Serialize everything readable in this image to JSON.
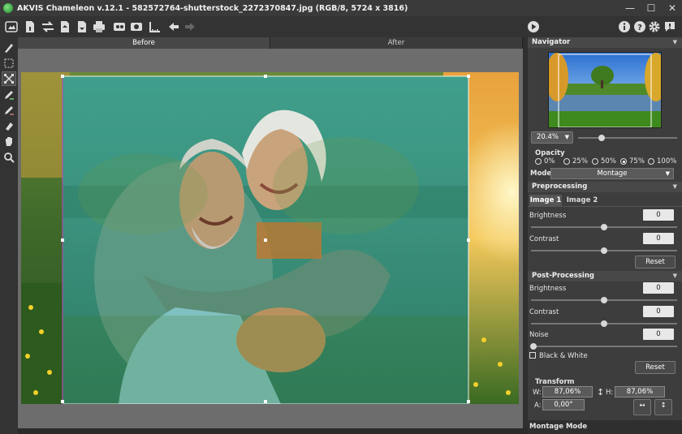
{
  "window": {
    "title": "AKVIS Chameleon v.12.1 - 582572764-shutterstock_2272370847.jpg (RGB/8, 5724 x 3816)"
  },
  "toolbar": {
    "icons": [
      "open-image-icon",
      "save-as-icon",
      "swap-images-icon",
      "upload-icon",
      "download-icon",
      "print-icon",
      "share-icon",
      "batch-icon",
      "ruler-icon",
      "undo-icon",
      "redo-icon",
      "run-icon",
      "info-icon",
      "help-icon",
      "settings-icon",
      "notifications-icon"
    ]
  },
  "tools": [
    "hand-brush-icon",
    "selection-icon",
    "chameleon-mode-icon",
    "mask-pencil-icon",
    "eraser-icon",
    "eraser2-icon",
    "hand-tool-icon",
    "zoom-tool-icon"
  ],
  "view_tabs": {
    "before": "Before",
    "after": "After"
  },
  "navigator": {
    "title": "Navigator",
    "zoom": "20.4%"
  },
  "opacity": {
    "label": "Opacity",
    "options": [
      "0%",
      "25%",
      "50%",
      "75%",
      "100%"
    ],
    "selected": "75%"
  },
  "mode": {
    "label": "Mode",
    "value": "Montage"
  },
  "preprocessing": {
    "title": "Preprocessing",
    "tab1": "Image 1",
    "tab2": "Image 2",
    "brightness_label": "Brightness",
    "brightness_value": "0",
    "contrast_label": "Contrast",
    "contrast_value": "0",
    "reset": "Reset"
  },
  "postprocessing": {
    "title": "Post-Processing",
    "brightness_label": "Brightness",
    "brightness_value": "0",
    "contrast_label": "Contrast",
    "contrast_value": "0",
    "noise_label": "Noise",
    "noise_value": "0",
    "bw_label": "Black & White",
    "reset": "Reset"
  },
  "transform": {
    "title": "Transform",
    "w_label": "W:",
    "w_value": "87,06%",
    "h_label": "H:",
    "h_value": "87,06%",
    "a_label": "A:",
    "a_value": "0,00°"
  },
  "footer": {
    "montage_mode": "Montage Mode"
  }
}
